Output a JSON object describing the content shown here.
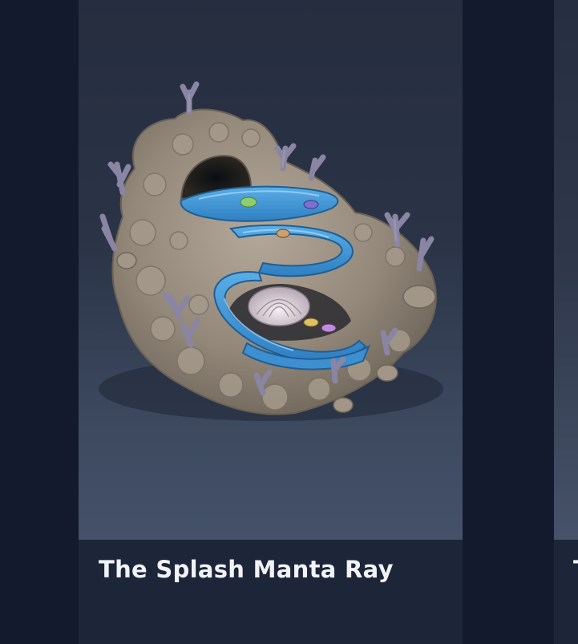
{
  "carousel": {
    "cards": [
      {
        "title": "The Splash Manta Ray",
        "image_alt": "coral reef rock with blue spiral water slide"
      },
      {
        "title": "T",
        "image_alt": "partially visible next card"
      }
    ]
  },
  "colors": {
    "page_background": "#131a2e",
    "caption_background": "#1d2539",
    "title_text": "#f1f3f7",
    "slide_blue": "#3d8fd0"
  }
}
